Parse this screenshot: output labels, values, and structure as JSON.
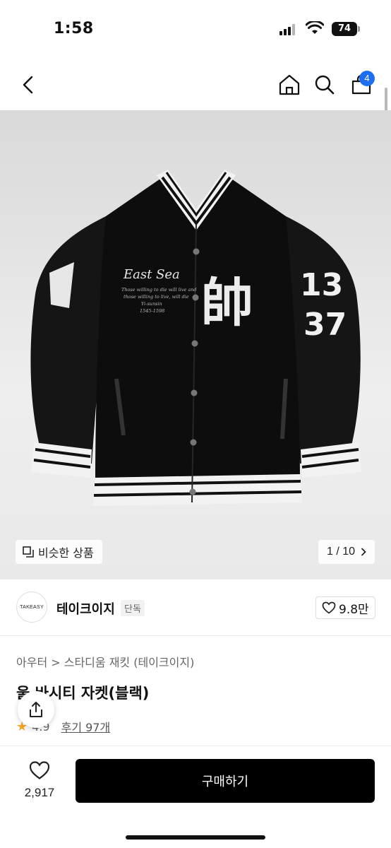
{
  "status": {
    "time": "1:58",
    "battery": "74"
  },
  "nav": {
    "cart_count": "4"
  },
  "image": {
    "similar_label": "비슷한 상품",
    "page_counter": "1 / 10",
    "jacket_text": {
      "script": "East Sea",
      "line1": "Those willing to die will live and",
      "line2": "those willing to live, will die",
      "line3": "Yi-sunsin",
      "line4": "1545-1598",
      "patch": "帥",
      "sleeve_top": "13",
      "sleeve_bottom": "37"
    }
  },
  "brand": {
    "logo_text": "TAKEASY",
    "name": "테이크이지",
    "tag": "단독",
    "likes": "9.8만"
  },
  "product": {
    "breadcrumb": "아우터 > 스타디움 재킷 (테이크이지)",
    "title": "울 바시티 자켓(블랙)",
    "rating": "4.9",
    "reviews": "후기 97개"
  },
  "bottom": {
    "wish_count": "2,917",
    "buy_label": "구매하기"
  },
  "colors": {
    "accent": "#1e6ff0",
    "button": "#000000",
    "star": "#f5a623"
  }
}
